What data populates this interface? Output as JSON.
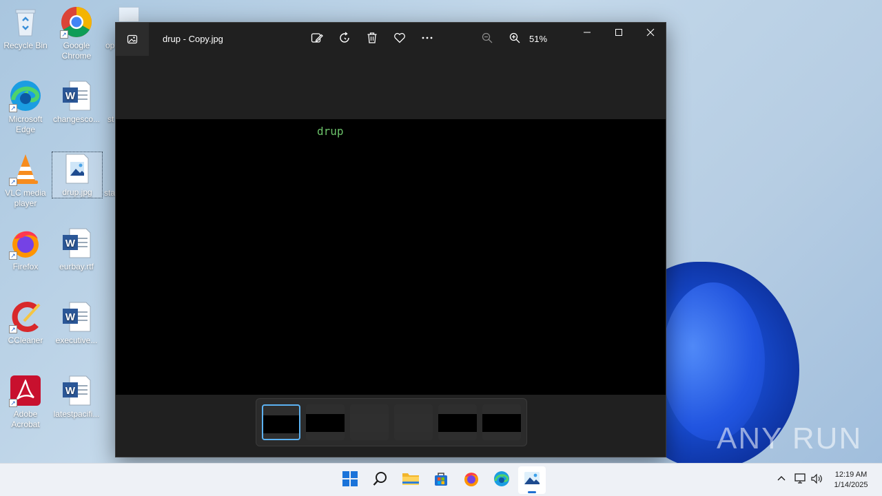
{
  "desktop": {
    "icons": [
      {
        "label": "Recycle Bin"
      },
      {
        "label": "Google Chrome"
      },
      {
        "label": "op"
      },
      {
        "label": "Microsoft Edge"
      },
      {
        "label": "changesco..."
      },
      {
        "label": "st"
      },
      {
        "label": "VLC media player"
      },
      {
        "label": "drup.jpg"
      },
      {
        "label": "sta"
      },
      {
        "label": "Firefox"
      },
      {
        "label": "eurbay.rtf"
      },
      {
        "label": "CCleaner"
      },
      {
        "label": "executive..."
      },
      {
        "label": "Adobe Acrobat"
      },
      {
        "label": "latestpacifi..."
      }
    ]
  },
  "window": {
    "title": "drup - Copy.jpg",
    "zoom": "51%",
    "toolbar": [
      "edit-icon",
      "rotate-icon",
      "delete-icon",
      "favorite-icon",
      "more-icon",
      "zoom-out-icon",
      "zoom-in-icon"
    ],
    "photo_text": "drup",
    "filmstrip_count": 6,
    "active_thumb": 1
  },
  "taskbar": {
    "apps": [
      "start-icon",
      "search-icon",
      "file-explorer-icon",
      "store-icon",
      "firefox-icon",
      "edge-icon",
      "photos-icon"
    ],
    "clock": {
      "time": "12:19 AM",
      "date": "1/14/2025"
    }
  },
  "watermark": "ANY RUN",
  "colors": {
    "accent": "#5cb2f2",
    "photo_text": "#6cc26a",
    "window_bg": "#202020"
  }
}
